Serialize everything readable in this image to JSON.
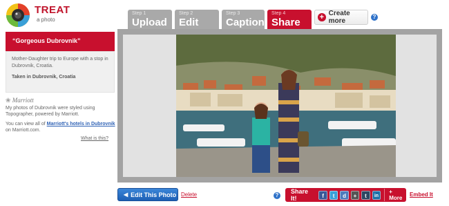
{
  "app": {
    "logo_title": "TREAT",
    "logo_sub": "a photo",
    "brand_color": "#c8102e"
  },
  "steps": [
    {
      "number": "Step 1",
      "name": "Upload",
      "active": false
    },
    {
      "number": "Step 2",
      "name": "Edit",
      "active": false
    },
    {
      "number": "Step 3",
      "name": "Caption",
      "active": false
    },
    {
      "number": "Step 4",
      "name": "Share",
      "active": true
    }
  ],
  "create_more": {
    "icon": "plus-circle-icon",
    "label": "Create more"
  },
  "help_icon": "?",
  "card": {
    "title": "“Gorgeous Dubrovnik”",
    "description": "Mother-Daughter trip to Europe with a stop in Dubrovnik, Croatia.",
    "taken": "Taken in Dubrovnik, Croatia"
  },
  "sponsor": {
    "logo": "Marriott",
    "text": "My photos of Dubrovnik were styled using Topographer, powered by Marriott.",
    "text2_prefix": "You can view all of ",
    "text2_link": "Marriott's hotels in Dubrovnik",
    "text2_suffix": " on Marriott.com.",
    "what_link": "What is this?"
  },
  "toolbar": {
    "edit_label": "Edit This Photo",
    "delete_label": "Delete",
    "share_label": "Share It!",
    "share_buttons": [
      {
        "icon": "facebook-icon",
        "glyph": "f",
        "color": "#3b5998"
      },
      {
        "icon": "twitter-icon",
        "glyph": "t",
        "color": "#3aa0d8"
      },
      {
        "icon": "digg-icon",
        "glyph": "d",
        "color": "#4d7bbd"
      },
      {
        "icon": "plus-icon",
        "glyph": "+",
        "color": "#555555"
      },
      {
        "icon": "tumblr-icon",
        "glyph": "t",
        "color": "#2c4762"
      },
      {
        "icon": "linkedin-icon",
        "glyph": "in",
        "color": "#1d6fa8"
      }
    ],
    "more_label": "+ More",
    "embed_label": "Embed It"
  }
}
